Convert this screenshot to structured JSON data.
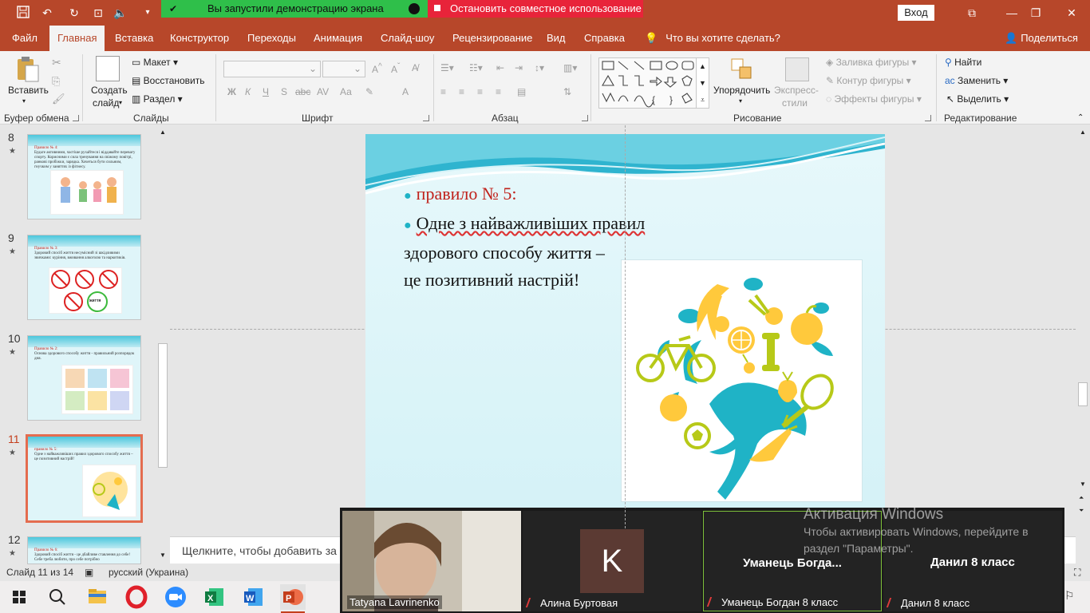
{
  "title_bar": {
    "login_label": "Вход",
    "share_notice": "Вы запустили демонстрацию экрана",
    "stop_share": "Остановить совместное использование"
  },
  "tabs": [
    "Файл",
    "Главная",
    "Вставка",
    "Конструктор",
    "Переходы",
    "Анимация",
    "Слайд-шоу",
    "Рецензирование",
    "Вид",
    "Справка"
  ],
  "tell_me": "Что вы хотите сделать?",
  "share_label": "Поделиться",
  "ribbon": {
    "paste": "Вставить",
    "new_slide": [
      "Создать",
      "слайд"
    ],
    "layout": "Макет",
    "reset": "Восстановить",
    "section": "Раздел",
    "arrange": "Упорядочить",
    "quick_styles": [
      "Экспресс-",
      "стили"
    ],
    "shape_fill": "Заливка фигуры",
    "shape_outline": "Контур фигуры",
    "shape_effects": "Эффекты фигуры",
    "find": "Найти",
    "replace": "Заменить",
    "select": "Выделить",
    "font_buttons": [
      "Ж",
      "К",
      "Ч",
      "S",
      "abc",
      "AV",
      "Аа",
      "A"
    ],
    "groups": {
      "clipboard": "Буфер обмена",
      "slides": "Слайды",
      "font": "Шрифт",
      "paragraph": "Абзац",
      "drawing": "Рисование",
      "editing": "Редактирование"
    }
  },
  "thumbnails": [
    {
      "number": "8",
      "lines": [
        "Правило № 4:",
        "Будьте активними, частіше рухайтеся і віддавайте перевагу спорту. Корисними є сила тренування на свіжому повітрі, ранкові пробіжки, зарядка. Хочеться бути сильним, гнучким у заняттях із фітнесу."
      ]
    },
    {
      "number": "9",
      "lines": [
        "Правило № 3:",
        "Здоровий спосіб життя несумісний зі шкідливими звичками: куріння, вживання алкоголю та наркотиків."
      ],
      "badge": "життя"
    },
    {
      "number": "10",
      "lines": [
        "Правило № 2:",
        "Основа здорового способу життя - правильний розпорядок дня."
      ]
    },
    {
      "number": "11",
      "lines": [
        "правило № 5:",
        "Одне з найважливіших правил здорового способу життя –",
        "це позитивний настрій!"
      ]
    },
    {
      "number": "12",
      "lines": [
        "Правило № 6:",
        "Здоровий спосіб життя - це дбайливе ставлення до себе! Себе треба любити, про себе потрібно"
      ]
    }
  ],
  "slide": {
    "rule": "правило № 5:",
    "text_line1": "Одне з найважливіших правил",
    "text_line2": "здорового способу життя –",
    "text_line3": "це позитивний настрій!"
  },
  "notes_placeholder": "Щелкните, чтобы добавить за",
  "status": {
    "slide_counter": "Слайд 11 из 14",
    "language": "русский (Украина)"
  },
  "zoom": {
    "participants": [
      {
        "name": "Tatyana Lavrinenko"
      },
      {
        "name": "Алина Буртовая",
        "initial": "K"
      },
      {
        "name": "Уманець Богдан 8 класс",
        "display": "Уманець  Богда..."
      },
      {
        "name": "Данил 8 класс",
        "display": "Данил 8 класс"
      }
    ]
  },
  "activation": {
    "title": "Активация Windows",
    "line1": "Чтобы активировать Windows, перейдите в",
    "line2": "раздел \"Параметры\"."
  },
  "colors": {
    "accent": "#b7472a",
    "share_green": "#2fbf4a",
    "stop_red": "#e8243a",
    "slide_teal": "#1fb3c6",
    "slide_yellow": "#ffc93c",
    "slide_lime": "#b7c918"
  }
}
